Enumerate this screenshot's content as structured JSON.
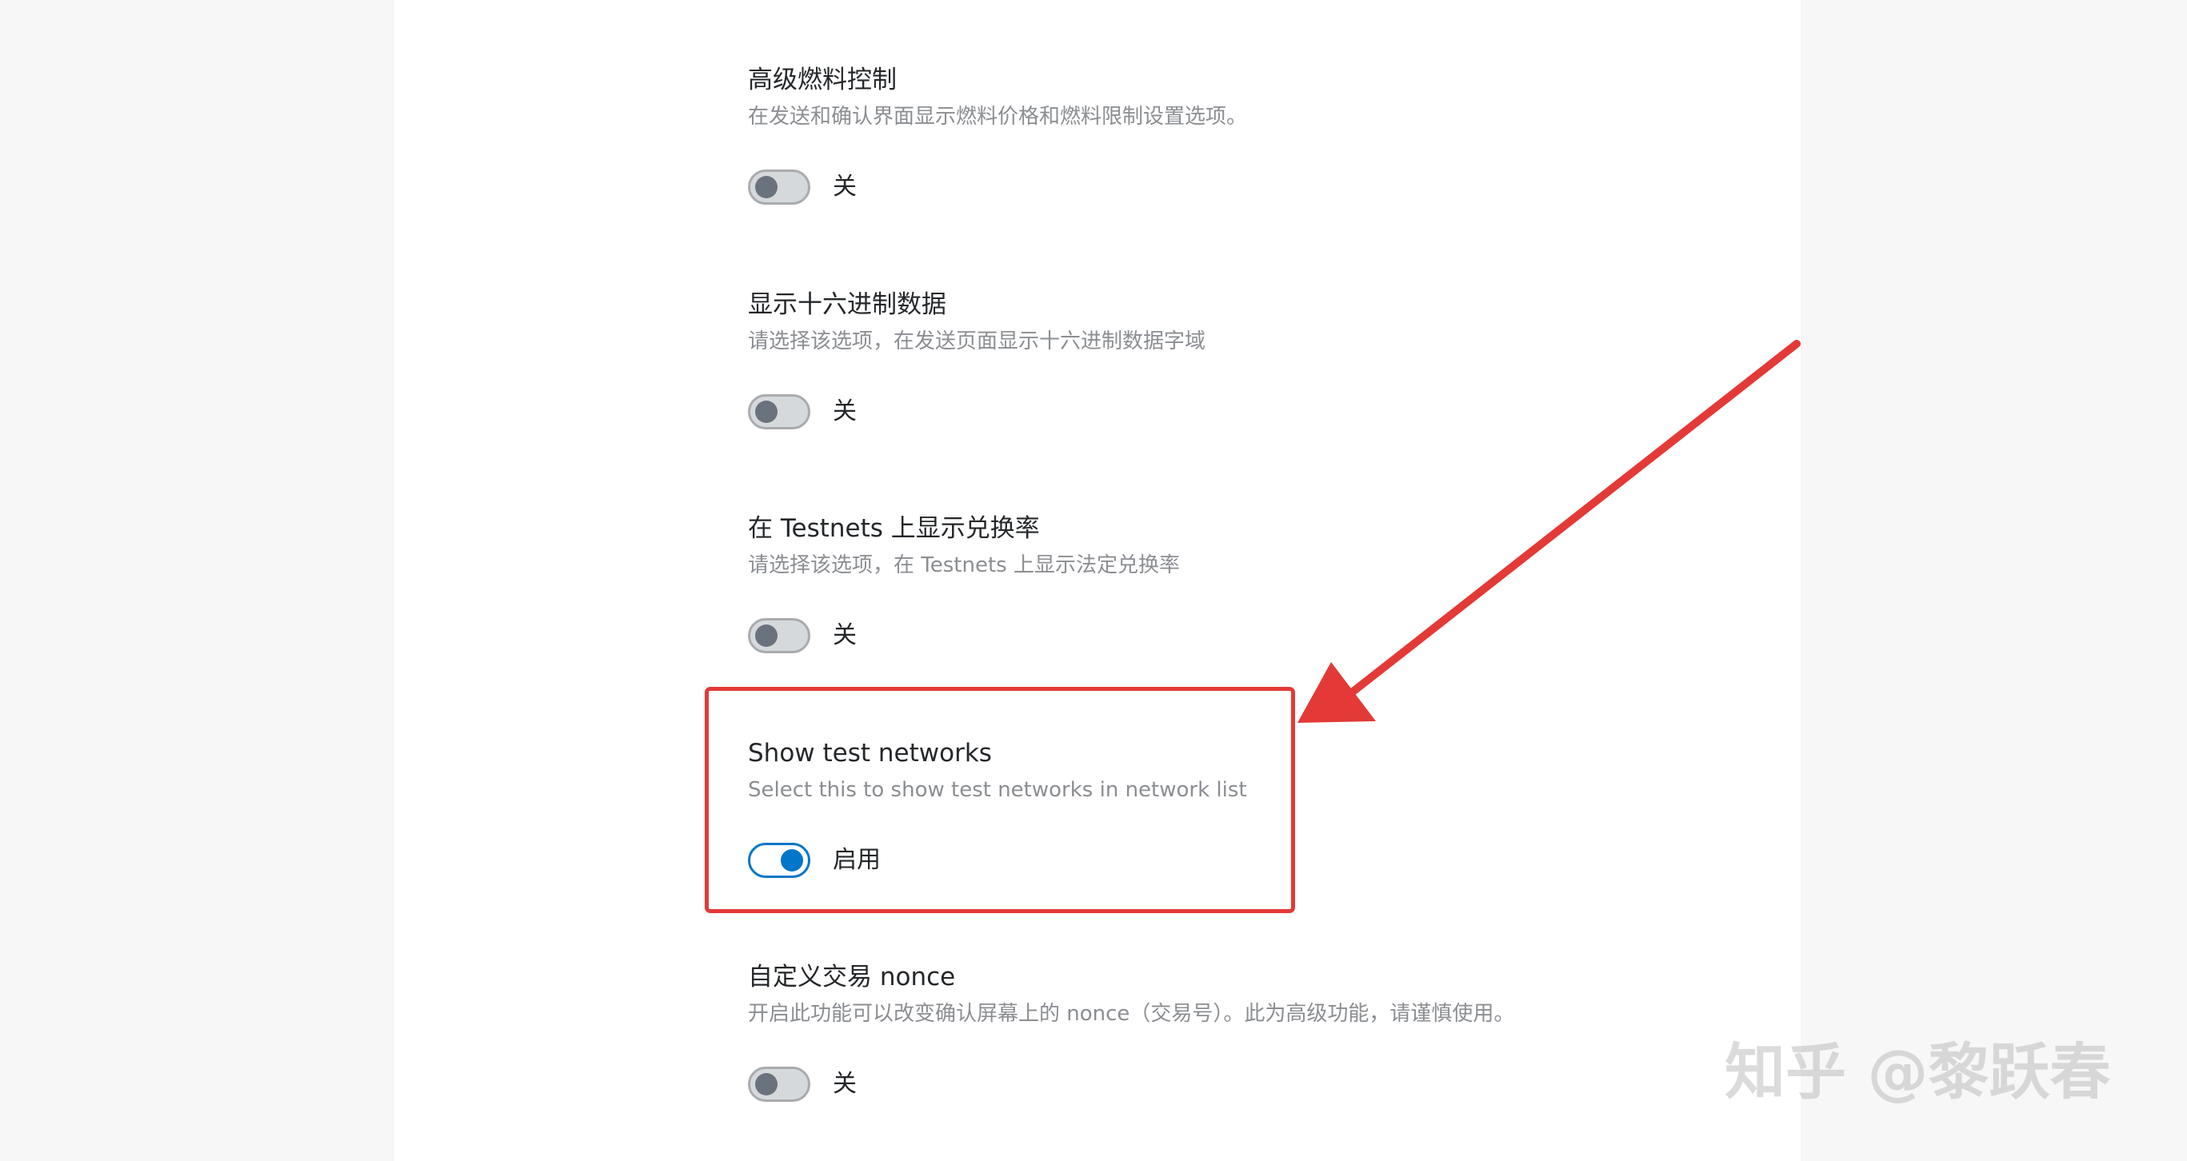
{
  "settings": [
    {
      "title": "高级燃料控制",
      "description": "在发送和确认界面显示燃料价格和燃料限制设置选项。",
      "toggle_label": "关"
    },
    {
      "title": "显示十六进制数据",
      "description": "请选择该选项，在发送页面显示十六进制数据字域",
      "toggle_label": "关"
    },
    {
      "title": "在 Testnets 上显示兑换率",
      "description": "请选择该选项，在 Testnets 上显示法定兑换率",
      "toggle_label": "关"
    },
    {
      "title": "Show test networks",
      "description": "Select this to show test networks in network list",
      "toggle_label": "启用"
    },
    {
      "title": "自定义交易 nonce",
      "description": "开启此功能可以改变确认屏幕上的 nonce（交易号）。此为高级功能，请谨慎使用。",
      "toggle_label": "关"
    }
  ],
  "watermark": "知乎 @黎跃春",
  "colors": {
    "toggle_on": "#0376c9",
    "toggle_off_knob": "#6a737d",
    "annotation_red": "#e33a37"
  }
}
